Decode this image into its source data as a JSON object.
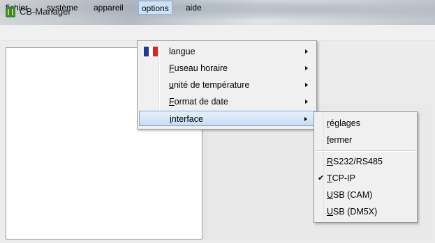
{
  "window": {
    "title": "CB-Manager",
    "icon": "app-logo-icon"
  },
  "menubar": {
    "items": [
      {
        "label": "fichier"
      },
      {
        "label": "système"
      },
      {
        "label": "appareil"
      },
      {
        "label": "options",
        "open": true
      },
      {
        "label": "aide"
      }
    ]
  },
  "options_menu": {
    "items": [
      {
        "mnemonic": "",
        "rest": "langue",
        "icon": "french-flag-icon",
        "submenu": true
      },
      {
        "mnemonic": "F",
        "rest": "useau horaire",
        "submenu": true
      },
      {
        "mnemonic": "u",
        "rest": "nité de température",
        "submenu": true
      },
      {
        "mnemonic": "F",
        "rest": "ormat de date",
        "submenu": true
      },
      {
        "mnemonic": "i",
        "rest": "nterface",
        "submenu": true,
        "highlighted": true
      }
    ]
  },
  "interface_submenu": {
    "items": [
      {
        "mnemonic": "r",
        "rest": "églages",
        "checked": false
      },
      {
        "mnemonic": "f",
        "rest": "ermer",
        "checked": false
      },
      {
        "mnemonic": "R",
        "rest": "S232/RS485",
        "checked": false
      },
      {
        "mnemonic": "T",
        "rest": "CP-IP",
        "checked": true,
        "check_glyph": "✔"
      },
      {
        "mnemonic": "U",
        "rest": "SB (CAM)",
        "checked": false
      },
      {
        "mnemonic": "U",
        "rest": "SB (DM5X)",
        "checked": false
      }
    ]
  },
  "colors": {
    "flag_blue": "#1f3a93",
    "flag_white": "#ffffff",
    "flag_red": "#d62828",
    "highlight": "#c8ddf3"
  }
}
